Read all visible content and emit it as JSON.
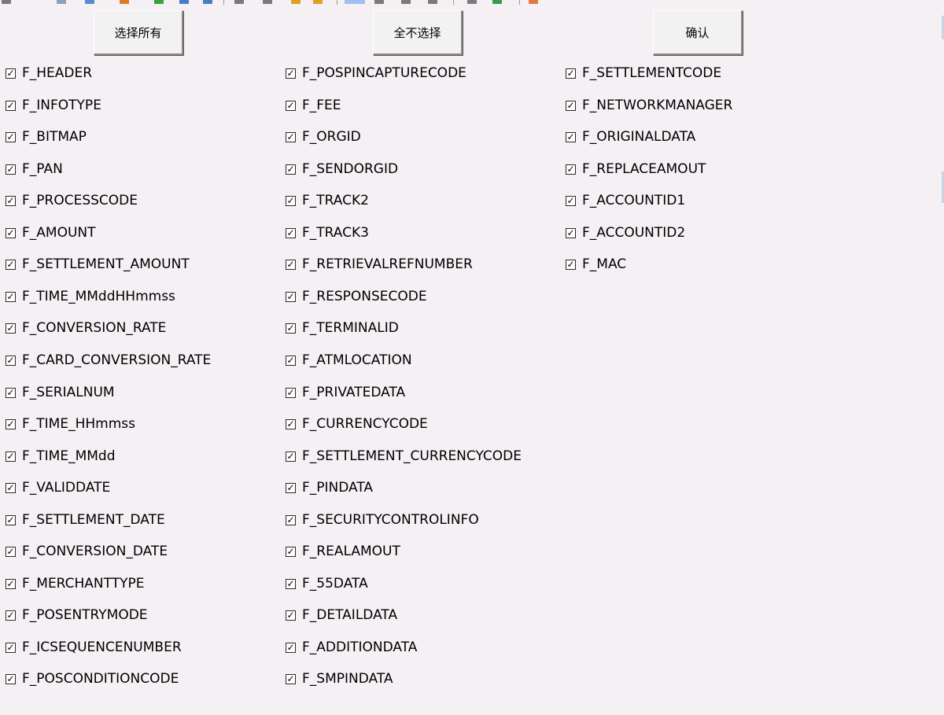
{
  "buttons": {
    "select_all": "选择所有",
    "select_none": "全不选择",
    "confirm": "确认"
  },
  "checkbox_state": "checked",
  "columns": [
    [
      "F_HEADER",
      "F_INFOTYPE",
      "F_BITMAP",
      "F_PAN",
      "F_PROCESSCODE",
      "F_AMOUNT",
      "F_SETTLEMENT_AMOUNT",
      "F_TIME_MMddHHmmss",
      "F_CONVERSION_RATE",
      "F_CARD_CONVERSION_RATE",
      "F_SERIALNUM",
      "F_TIME_HHmmss",
      "F_TIME_MMdd",
      "F_VALIDDATE",
      "F_SETTLEMENT_DATE",
      "F_CONVERSION_DATE",
      "F_MERCHANTTYPE",
      "F_POSENTRYMODE",
      "F_ICSEQUENCENUMBER",
      "F_POSCONDITIONCODE"
    ],
    [
      "F_POSPINCAPTURECODE",
      "F_FEE",
      "F_ORGID",
      "F_SENDORGID",
      "F_TRACK2",
      "F_TRACK3",
      "F_RETRIEVALREFNUMBER",
      "F_RESPONSECODE",
      "F_TERMINALID",
      "F_ATMLOCATION",
      "F_PRIVATEDATA",
      "F_CURRENCYCODE",
      "F_SETTLEMENT_CURRENCYCODE",
      "F_PINDATA",
      "F_SECURITYCONTROLINFO",
      "F_REALAMOUT",
      "F_55DATA",
      "F_DETAILDATA",
      "F_ADDITIONDATA",
      "F_SMPINDATA"
    ],
    [
      "F_SETTLEMENTCODE",
      "F_NETWORKMANAGER",
      "F_ORIGINALDATA",
      "F_REPLACEAMOUT",
      "F_ACCOUNTID1",
      "F_ACCOUNTID2",
      "F_MAC"
    ]
  ]
}
